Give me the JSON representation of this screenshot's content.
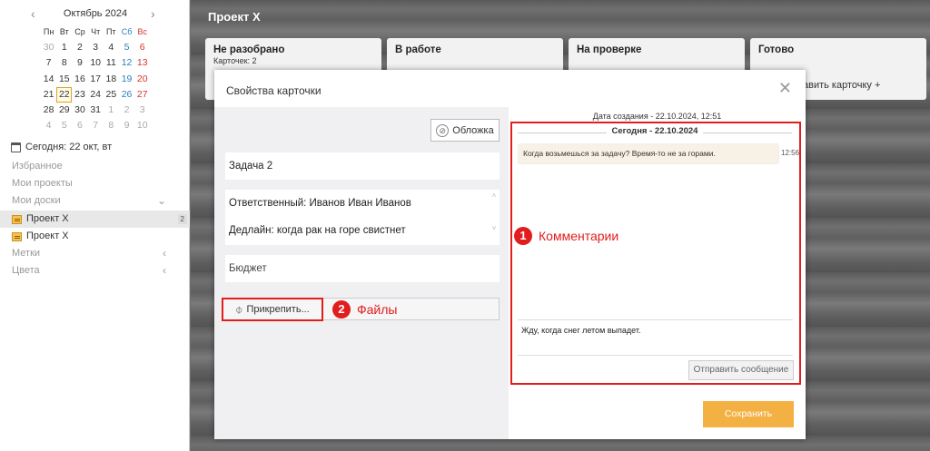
{
  "calendar": {
    "title": "Октябрь 2024",
    "prev": "‹",
    "next": "›",
    "weekdays": [
      "Пн",
      "Вт",
      "Ср",
      "Чт",
      "Пт",
      "Сб",
      "Вс"
    ],
    "weeks": [
      [
        "30",
        "1",
        "2",
        "3",
        "4",
        "5",
        "6"
      ],
      [
        "7",
        "8",
        "9",
        "10",
        "11",
        "12",
        "13"
      ],
      [
        "14",
        "15",
        "16",
        "17",
        "18",
        "19",
        "20"
      ],
      [
        "21",
        "22",
        "23",
        "24",
        "25",
        "26",
        "27"
      ],
      [
        "28",
        "29",
        "30",
        "31",
        "1",
        "2",
        "3"
      ],
      [
        "4",
        "5",
        "6",
        "7",
        "8",
        "9",
        "10"
      ]
    ]
  },
  "sidebar": {
    "today": "Сегодня: 22 окт, вт",
    "favorites": "Избранное",
    "my_projects": "Мои проекты",
    "my_boards": "Мои доски",
    "board1": "Проект X",
    "board1_count": "2",
    "board2": "Проект X",
    "labels": "Метки",
    "colors": "Цвета"
  },
  "board": {
    "title": "Проект X",
    "columns": [
      {
        "title": "Не разобрано",
        "sub": "Карточек: 2"
      },
      {
        "title": "В работе"
      },
      {
        "title": "На проверке"
      },
      {
        "title": "Готово"
      }
    ],
    "add_card": "авить карточку +"
  },
  "modal": {
    "title": "Свойства карточки",
    "close": "✕",
    "cover_button": "Обложка",
    "card_name": "Задача 2",
    "desc_line1": "Ответственный: Иванов Иван Иванов",
    "desc_line2": "Дедлайн: когда рак на горе свистнет",
    "budget": "Бюджет",
    "attach_button": "Прикрепить...",
    "created": "Дата создания - 22.10.2024, 12:51",
    "day_separator": "Сегодня - 22.10.2024",
    "message_text": "Когда возьмешься за задачу? Время-то не за горами.",
    "message_time": "12:56",
    "reply_text": "Жду, когда снег летом выпадет.",
    "send_button": "Отправить сообщение",
    "save_button": "Сохранить"
  },
  "annotations": {
    "comments_num": "1",
    "comments_label": "Комментарии",
    "files_num": "2",
    "files_label": "Файлы"
  },
  "colors": {
    "accent_red": "#e21d1d",
    "save_orange": "#f4b143",
    "today_border": "#e0a31b"
  }
}
